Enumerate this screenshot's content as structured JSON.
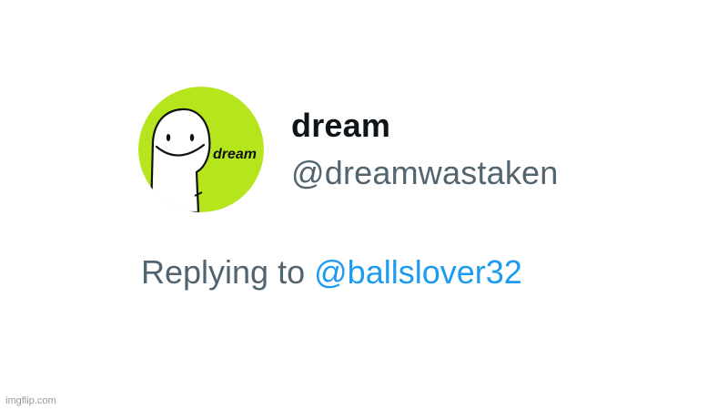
{
  "tweet": {
    "display_name": "dream",
    "handle": "@dreamwastaken",
    "avatar_icon": "dream-smiley-avatar-icon",
    "avatar_text": "dream",
    "avatar_color": "#b5e61d"
  },
  "reply": {
    "prefix": "Replying to",
    "mention": "@ballslover32",
    "mention_color": "#1d9bf0"
  },
  "watermark": {
    "text": "imgflip.com"
  }
}
